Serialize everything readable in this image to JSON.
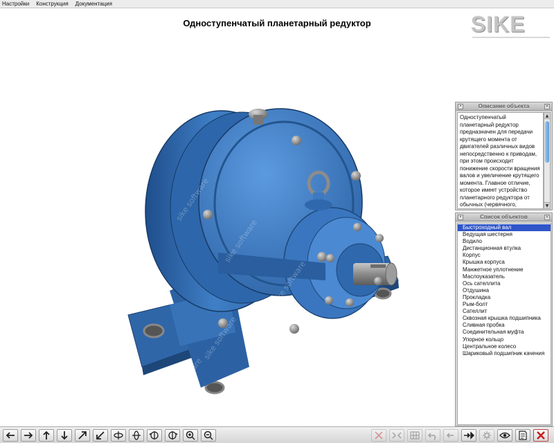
{
  "menu": {
    "items": [
      "Настройки",
      "Конструкция",
      "Документация"
    ]
  },
  "header": {
    "title": "Одноступенчатый планетарный редуктор"
  },
  "logo": {
    "text": "SIKE"
  },
  "description_panel": {
    "title": "Описание объекта",
    "text": "Одноступенчатый планетарный редуктор предназначен для передачи крутящего момента от двигателей различных видов непосредственно к приводам, при этом происходит понижение скорости вращения валов и увеличение крутящего момента. Главное отличие, которое имеет устройство планетарного редуктора от обычных (червячного, цилиндрического, конического"
  },
  "objects_panel": {
    "title": "Список объектов",
    "selected_index": 0,
    "items": [
      {
        "label": "Быстроходный вал"
      },
      {
        "label": "Ведущая шестерня"
      },
      {
        "label": "Водило"
      },
      {
        "label": "Дистанционная втулка"
      },
      {
        "label": "Корпус"
      },
      {
        "label": "Крышка корпуса"
      },
      {
        "label": "Манжетное уплотнение"
      },
      {
        "label": "Маслоуказатель"
      },
      {
        "label": "Ось сателлита"
      },
      {
        "label": "Отдушина"
      },
      {
        "label": "Прокладка"
      },
      {
        "label": "Рым-болт"
      },
      {
        "label": "Сателлит"
      },
      {
        "label": "Сквозная крышка подшипника"
      },
      {
        "label": "Сливная пробка"
      },
      {
        "label": "Соединительная муфта"
      },
      {
        "label": "Упорное кольцо"
      },
      {
        "label": "Центральное колесо"
      },
      {
        "label": "Шариковый подшипник качения"
      }
    ]
  },
  "viewport": {
    "watermark": "sike software"
  },
  "colors": {
    "model_blue": "#3f7fc6",
    "selection": "#2f55c8",
    "close_red": "#d01818"
  },
  "toolbar": {
    "left_tools": [
      {
        "icon": "arrow-left-icon"
      },
      {
        "icon": "arrow-right-icon"
      },
      {
        "icon": "arrow-up-icon"
      },
      {
        "icon": "arrow-down-icon"
      },
      {
        "icon": "arrow-diagonal-up-icon"
      },
      {
        "icon": "arrow-diagonal-down-icon"
      },
      {
        "icon": "rotate-y-icon"
      },
      {
        "icon": "rotate-x-icon"
      },
      {
        "icon": "rotate-z-left-icon"
      },
      {
        "icon": "rotate-z-right-icon"
      },
      {
        "icon": "zoom-in-icon"
      },
      {
        "icon": "zoom-out-icon"
      }
    ],
    "right_tools": [
      {
        "icon": "explode-cross-icon",
        "disabled": true
      },
      {
        "icon": "assemble-icon",
        "disabled": true
      },
      {
        "icon": "grid-icon",
        "disabled": true
      },
      {
        "icon": "undo-icon",
        "disabled": true
      },
      {
        "icon": "step-back-icon",
        "disabled": true
      },
      {
        "icon": "play-forward-icon",
        "disabled": false
      },
      {
        "icon": "settings-gear-icon",
        "disabled": true
      },
      {
        "icon": "view-eye-icon",
        "disabled": false
      },
      {
        "icon": "document-icon",
        "disabled": false
      },
      {
        "icon": "close-icon",
        "disabled": false
      }
    ]
  }
}
